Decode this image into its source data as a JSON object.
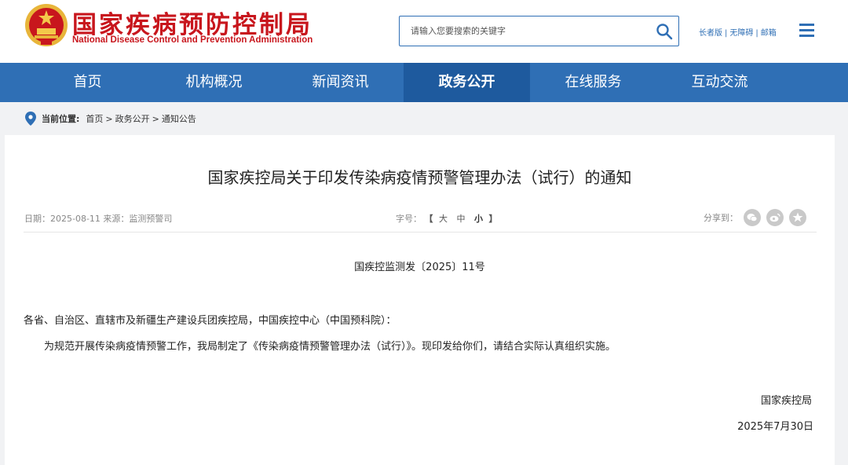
{
  "header": {
    "logo_cn": "国家疾病预防控制局",
    "logo_en": "National Disease Control and Prevention Administration",
    "emblem_icon": "national-emblem-icon",
    "search_placeholder": "请输入您要搜索的关键字",
    "top_links": [
      "长者版",
      "无障碍",
      "邮箱"
    ],
    "top_link_separator": "|"
  },
  "nav": {
    "items": [
      "首页",
      "机构概况",
      "新闻资讯",
      "政务公开",
      "在线服务",
      "互动交流"
    ],
    "active": "政务公开"
  },
  "breadcrumb": {
    "label": "当前位置:",
    "items": [
      "首页",
      "政务公开",
      "通知公告"
    ],
    "separator": ">"
  },
  "article": {
    "title": "国家疾控局关于印发传染病疫情预警管理办法（试行）的通知",
    "meta": "日期：2025-08-11 来源：监测预警司",
    "font_size_label": "字号：",
    "bracket_open": "【",
    "bracket_close": "】",
    "font_sizes": [
      "大",
      "中",
      "小"
    ],
    "share_label": "分享到：",
    "doc_number": "国疾控监测发〔2025〕11号",
    "addressee": "各省、自治区、直辖市及新疆生产建设兵团疾控局，中国疾控中心（中国预科院）：",
    "body": "为规范开展传染病疫情预警工作，我局制定了《传染病疫情预警管理办法（试行）》。现印发给你们，请结合实际认真组织实施。",
    "signature": "国家疾控局",
    "date": "2025年7月30日"
  },
  "colors": {
    "brand_red": "#c8161d",
    "nav_blue": "#2f6fb5",
    "nav_active": "#1e5a9e"
  }
}
